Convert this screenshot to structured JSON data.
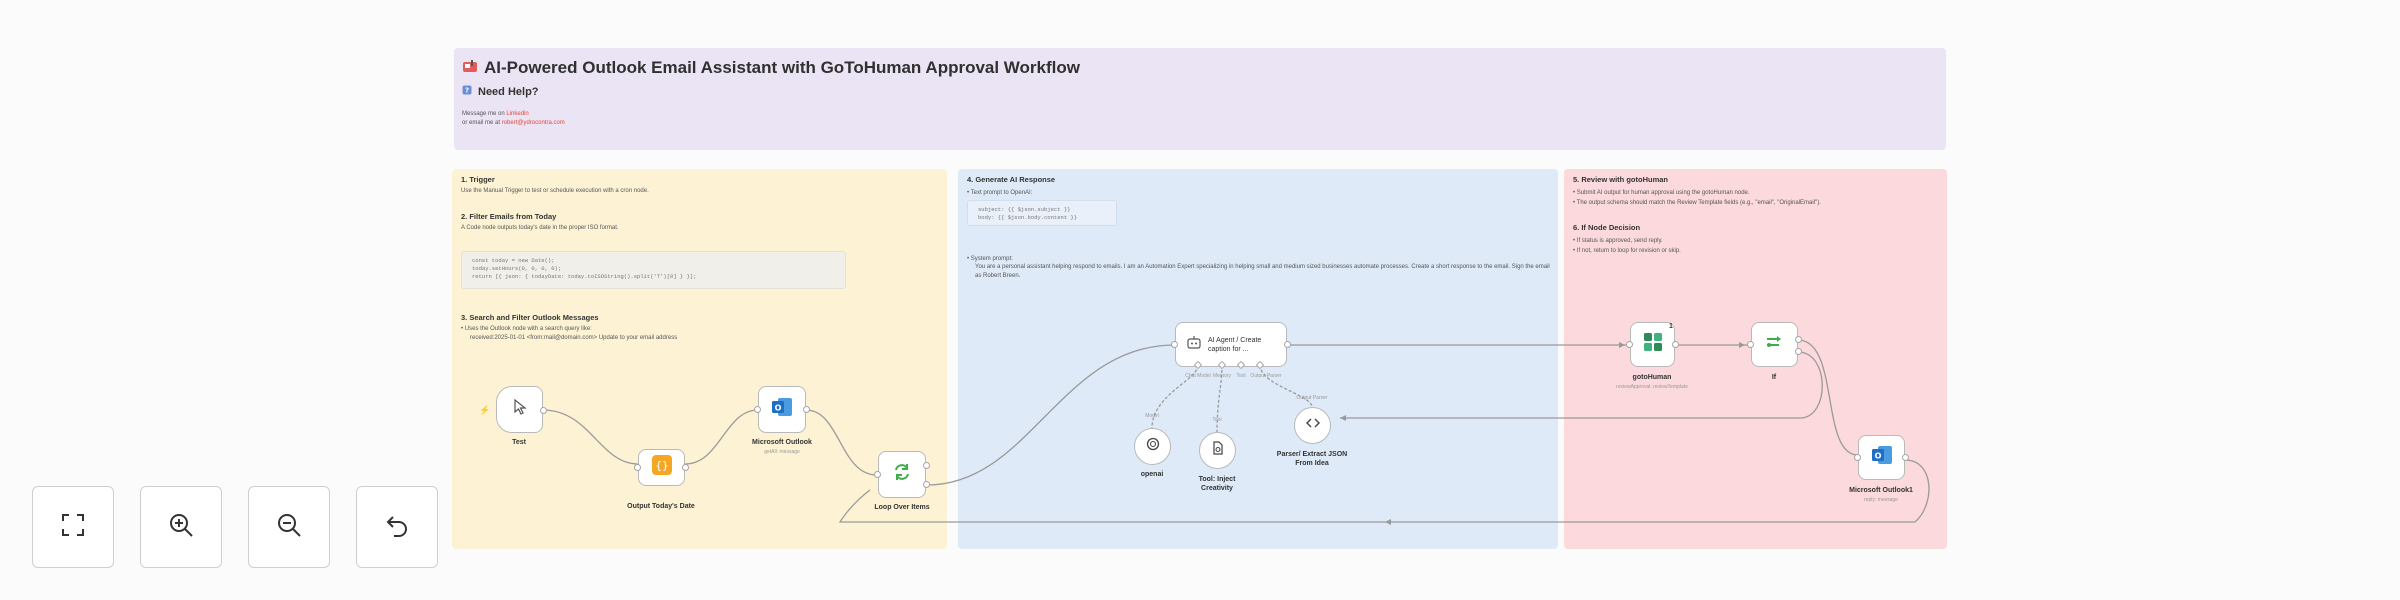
{
  "header": {
    "title": "AI-Powered Outlook Email Assistant with GoToHuman Approval Workflow",
    "help": "Need Help?",
    "line1_prefix": "Message me on ",
    "line1_link": "Linkedin",
    "line2_prefix": "or email me at ",
    "line2_link": "robert@ydrocontra.com"
  },
  "trigger_section": {
    "title1": "1. Trigger",
    "desc1": "Use the Manual Trigger to test or schedule execution with a cron node.",
    "title2": "2. Filter Emails from Today",
    "desc2": "A Code node outputs today's date in the proper ISO format.",
    "code_lines": [
      "const today = new Date();",
      "today.setHours(0, 0, 0, 0);",
      "return [{ json: { todayDate: today.toISOString().split('T')[0] } }];"
    ],
    "title3": "3. Search and Filter Outlook Messages",
    "bullet1": "Uses the Outlook node with a search query like:",
    "bullet1_code": "received:2025-01-01 <from:mail@domain.com> Update to your email address"
  },
  "ai_section": {
    "title": "4. Generate AI Response",
    "bullet1": "Text prompt to OpenAI:",
    "code_lines": [
      "subject: {{ $json.subject }}",
      "body: {{ $json.body.content }}"
    ],
    "bullet2": "System prompt:",
    "system_prompt": "You are a personal assistant helping respond to emails. I am an Automation Expert specializing in helping small and medium sized businesses automate processes. Create a short response to the email. Sign the email as Robert Breen."
  },
  "review_section": {
    "title1": "5. Review with gotoHuman",
    "b1": "Submit AI output for human approval using the gotoHuman node.",
    "b2": "The output schema should match the Review Template fields (e.g., \"email\", \"OriginalEmail\").",
    "title2": "6. If Node Decision",
    "b3": "If status is approved, send reply.",
    "b4": "If not, return to loop for revision or skip."
  },
  "nodes": {
    "test": {
      "label": "Test"
    },
    "code": {
      "label": "Output Today's Date"
    },
    "outlook_get": {
      "label": "Microsoft Outlook",
      "sub": "getAll: message"
    },
    "loop": {
      "label": "Loop Over Items"
    },
    "agent": {
      "line1": "AI Agent / Create",
      "line2": "caption for ...",
      "port1": "Chat Model",
      "port2": "Memory",
      "port3": "Tool",
      "port4": "Output Parser"
    },
    "openai": {
      "label": "openai",
      "sub": "Model"
    },
    "tool": {
      "label": "Tool: Inject",
      "label2": "Creativity",
      "sub": "Tool"
    },
    "parser": {
      "label": "Parser/ Extract JSON",
      "label2": "From Idea",
      "sub": "Output Parser"
    },
    "gotohuman": {
      "label": "gotoHuman",
      "sub": "reviewApproval: reviewTemplate",
      "badge": "1"
    },
    "if": {
      "label": "If"
    },
    "outlook_reply": {
      "label": "Microsoft Outlook1",
      "sub": "reply: message"
    }
  },
  "controls": {
    "fit": "fit-view-icon",
    "zoom_in": "zoom-in-icon",
    "zoom_out": "zoom-out-icon",
    "reset": "reset-zoom-icon"
  },
  "colors": {
    "title_bg": "#ebe4f4",
    "trigger_bg": "#fdf3d4",
    "ai_bg": "#deeaf8",
    "review_bg": "#fbd9dc",
    "connection": "#9a9a9a",
    "code_node": "#f5a623",
    "loop_node": "#3fae49",
    "outlook": "#1f6fc4",
    "gotohuman": "#2e8b57",
    "link": "#e0493c"
  }
}
